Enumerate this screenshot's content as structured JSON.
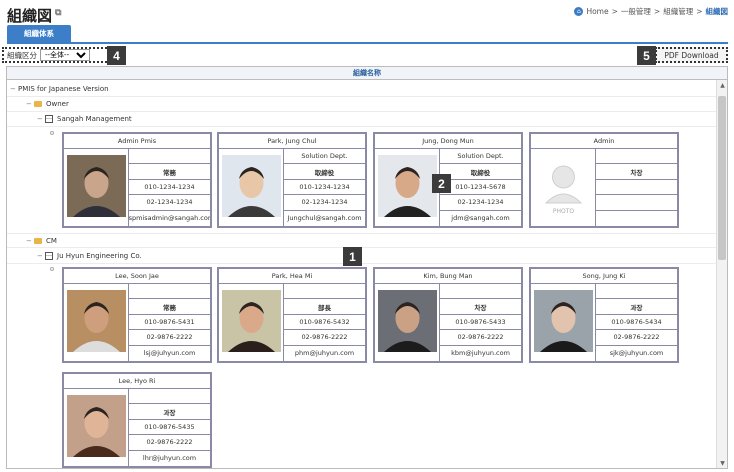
{
  "header": {
    "title": "組織図"
  },
  "breadcrumb": {
    "home": "Home",
    "sep": ">",
    "level1": "一般管理",
    "level2": "組織管理",
    "current": "組織図"
  },
  "tabs": [
    {
      "label": "組織体系"
    }
  ],
  "toolbar": {
    "filter_label": "組織区分",
    "filter_value": "--全体--",
    "pdf_label": "PDF Download"
  },
  "grid": {
    "header": "組織名称"
  },
  "badges": [
    "1",
    "2",
    "4",
    "5"
  ],
  "tree": {
    "root": "PMIS for Japanese Version",
    "group1": "Owner",
    "org1": "Sangah Management",
    "group2": "CM",
    "org2": "Ju Hyun Engineering Co."
  },
  "cards": [
    {
      "name": "Admin Pmis",
      "dept": "",
      "position": "常務",
      "phone": "010-1234-1234",
      "tel": "02-1234-1234",
      "email": "kspmisadmin@sangah.com",
      "photo": "person-photo"
    },
    {
      "name": "Park, Jung Chul",
      "dept": "Solution Dept.",
      "position": "取締役",
      "phone": "010-1234-1234",
      "tel": "02-1234-1234",
      "email": "Jungchul@sangah.com",
      "photo": "person-photo"
    },
    {
      "name": "Jung, Dong Mun",
      "dept": "Solution Dept.",
      "position": "取締役",
      "phone": "010-1234-5678",
      "tel": "02-1234-1234",
      "email": "jdm@sangah.com",
      "photo": "person-photo"
    },
    {
      "name": "Admin",
      "dept": "",
      "position": "차장",
      "phone": "",
      "tel": "",
      "email": "",
      "photo": "placeholder",
      "photo_text": "PHOTO"
    },
    {
      "name": "Lee, Soon Jae",
      "dept": "",
      "position": "常務",
      "phone": "010-9876-5431",
      "tel": "02-9876-2222",
      "email": "lsj@juhyun.com",
      "photo": "person-photo"
    },
    {
      "name": "Park, Hea Mi",
      "dept": "",
      "position": "部長",
      "phone": "010-9876-5432",
      "tel": "02-9876-2222",
      "email": "phm@juhyun.com",
      "photo": "person-photo"
    },
    {
      "name": "Kim, Bung Man",
      "dept": "",
      "position": "차장",
      "phone": "010-9876-5433",
      "tel": "02-9876-2222",
      "email": "kbm@juhyun.com",
      "photo": "person-photo"
    },
    {
      "name": "Song, Jung Ki",
      "dept": "",
      "position": "과장",
      "phone": "010-9876-5434",
      "tel": "02-9876-2222",
      "email": "sjk@juhyun.com",
      "photo": "person-photo"
    },
    {
      "name": "Lee, Hyo Ri",
      "dept": "",
      "position": "과장",
      "phone": "010-9876-5435",
      "tel": "02-9876-2222",
      "email": "lhr@juhyun.com",
      "photo": "person-photo"
    }
  ]
}
